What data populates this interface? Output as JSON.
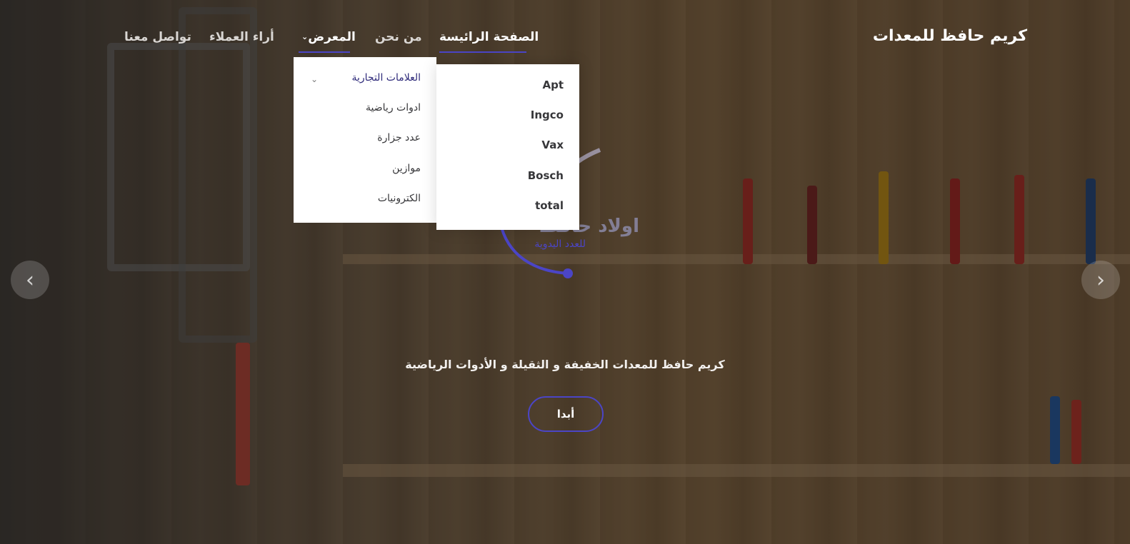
{
  "brand": {
    "name": "كريم حافظ للمعدات"
  },
  "nav": {
    "home": "الصفحة الرائيسة",
    "about": "من نحن",
    "gallery": "المعرض",
    "reviews": "أراء العملاء",
    "contact": "تواصل معنا"
  },
  "gallery_menu": {
    "items": [
      "العلامات التجارية",
      "ادوات رياضية",
      "عدد جزارة",
      "موازين",
      "الكترونيات"
    ]
  },
  "brands_menu": {
    "items": [
      "Apt",
      "Ingco",
      "Vax",
      "Bosch",
      "total"
    ]
  },
  "logo": {
    "text_main": "اولاد حافظ",
    "text_sub": "للعدد اليدوية"
  },
  "hero": {
    "caption": "كريم حافظ للمعدات الخفيفة و الثقيلة و الأدوات الرياضية",
    "cta": "أبدا"
  },
  "carousel": {
    "prev_icon": "chevron-left-icon",
    "next_icon": "chevron-right-icon"
  },
  "colors": {
    "accent": "#4b45c6",
    "dropdown_bg": "#ffffff",
    "menu_highlight": "#2e2a7a"
  }
}
